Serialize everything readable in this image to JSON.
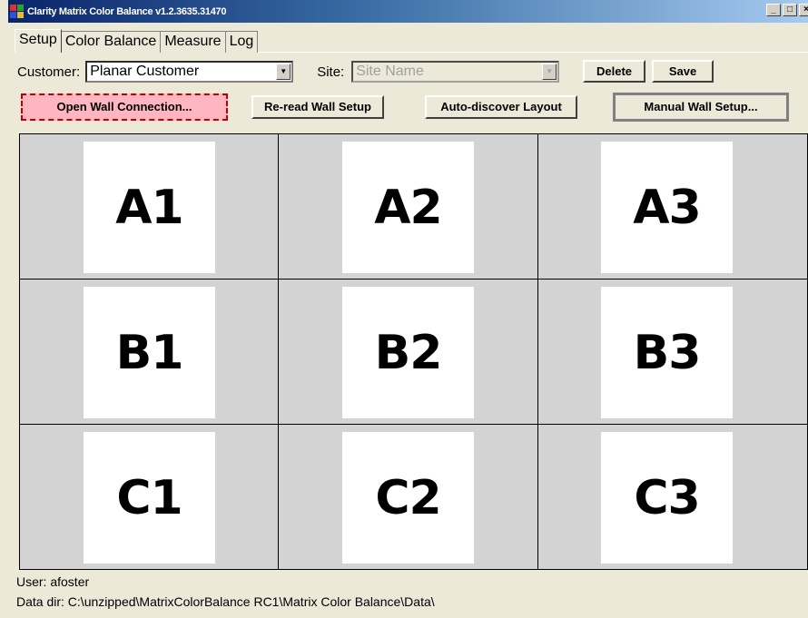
{
  "window": {
    "title": "Clarity Matrix Color Balance v1.2.3635.31470",
    "controls": [
      "_",
      "□",
      "×"
    ]
  },
  "tabs": [
    {
      "label": "Setup",
      "active": true
    },
    {
      "label": "Color Balance",
      "active": false
    },
    {
      "label": "Measure",
      "active": false
    },
    {
      "label": "Log",
      "active": false
    }
  ],
  "customer": {
    "label": "Customer:",
    "value": "Planar Customer"
  },
  "site": {
    "label": "Site:",
    "placeholder": "Site Name",
    "enabled": false
  },
  "buttons": {
    "delete": "Delete",
    "save": "Save",
    "open_wall": "Open Wall Connection...",
    "reread": "Re-read Wall Setup",
    "autodiscover": "Auto-discover Layout",
    "manual": "Manual Wall Setup..."
  },
  "wall": {
    "rows": [
      [
        "A1",
        "A2",
        "A3"
      ],
      [
        "B1",
        "B2",
        "B3"
      ],
      [
        "C1",
        "C2",
        "C3"
      ]
    ]
  },
  "status": {
    "user": "User: afoster",
    "data_dir": "Data dir: C:\\unzipped\\MatrixColorBalance RC1\\Matrix Color Balance\\Data\\"
  },
  "colors": {
    "highlight_button": "#ffb6c1",
    "highlight_border": "#c00000",
    "grid_background": "#d3d3d3"
  }
}
